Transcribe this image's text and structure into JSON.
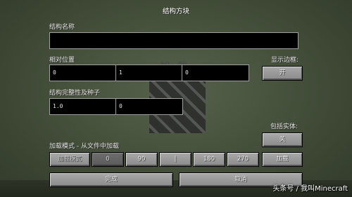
{
  "screen": {
    "title": "结构方块",
    "structure_name_label": "结构名称",
    "structure_name_value": "",
    "relative_position_label": "相对位置",
    "relative_position_values": [
      "0",
      "1",
      "0"
    ],
    "show_bounding_box_label": "显示边框:",
    "show_bounding_box_value": "开",
    "integrity_seed_label": "结构完整性及种子",
    "integrity_value": "1.0",
    "seed_value": "0",
    "include_entities_label": "包括实体:",
    "include_entities_value": "关",
    "load_mode_label": "加载模式 - 从文件中加载",
    "mode_button": "加载模式",
    "rotation_buttons": [
      "0",
      "90",
      "|",
      "180",
      "270"
    ],
    "load_button": "加载",
    "done_button": "完成",
    "cancel_button": "取消"
  },
  "background": {
    "ghost_text": "加 载"
  },
  "watermark": "头条号 / 我叫Minecraft"
}
